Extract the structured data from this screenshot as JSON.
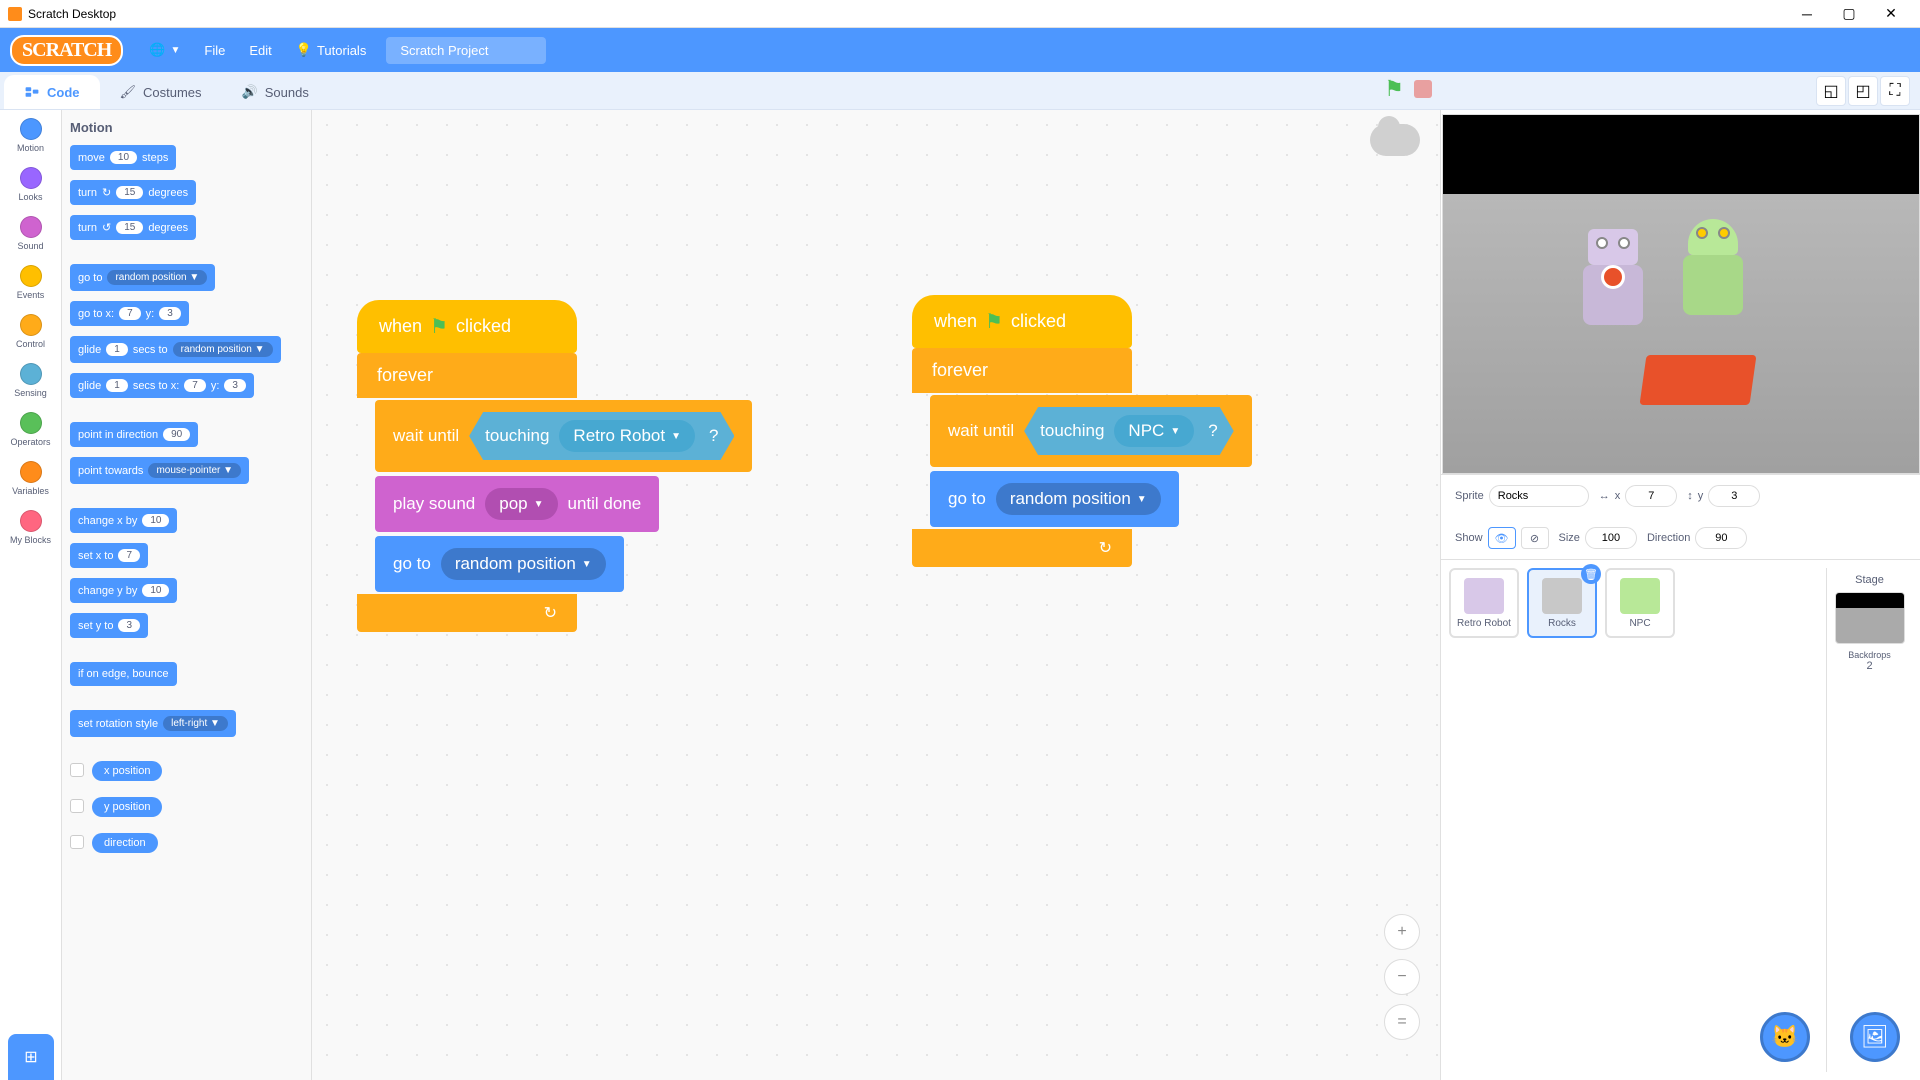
{
  "window_title": "Scratch Desktop",
  "menubar": {
    "logo": "SCRATCH",
    "file": "File",
    "edit": "Edit",
    "tutorials": "Tutorials",
    "project_name": "Scratch Project"
  },
  "tabs": {
    "code": "Code",
    "costumes": "Costumes",
    "sounds": "Sounds"
  },
  "categories": [
    {
      "label": "Motion",
      "color": "#4c97ff"
    },
    {
      "label": "Looks",
      "color": "#9966ff"
    },
    {
      "label": "Sound",
      "color": "#cf63cf"
    },
    {
      "label": "Events",
      "color": "#ffbf00"
    },
    {
      "label": "Control",
      "color": "#ffab19"
    },
    {
      "label": "Sensing",
      "color": "#5cb1d6"
    },
    {
      "label": "Operators",
      "color": "#59c059"
    },
    {
      "label": "Variables",
      "color": "#ff8c1a"
    },
    {
      "label": "My Blocks",
      "color": "#ff6680"
    }
  ],
  "palette": {
    "heading": "Motion",
    "move": {
      "t1": "move",
      "v": "10",
      "t2": "steps"
    },
    "turn_cw": {
      "t1": "turn",
      "v": "15",
      "t2": "degrees"
    },
    "turn_ccw": {
      "t1": "turn",
      "v": "15",
      "t2": "degrees"
    },
    "goto": {
      "t1": "go to",
      "dd": "random position"
    },
    "gotoxy": {
      "t1": "go to x:",
      "x": "7",
      "t2": "y:",
      "y": "3"
    },
    "glide": {
      "t1": "glide",
      "s": "1",
      "t2": "secs to",
      "dd": "random position"
    },
    "glidexy": {
      "t1": "glide",
      "s": "1",
      "t2": "secs to x:",
      "x": "7",
      "t3": "y:",
      "y": "3"
    },
    "pointdir": {
      "t1": "point in direction",
      "v": "90"
    },
    "pointtow": {
      "t1": "point towards",
      "dd": "mouse-pointer"
    },
    "changex": {
      "t1": "change x by",
      "v": "10"
    },
    "setx": {
      "t1": "set x to",
      "v": "7"
    },
    "changey": {
      "t1": "change y by",
      "v": "10"
    },
    "sety": {
      "t1": "set y to",
      "v": "3"
    },
    "bounce": "if on edge, bounce",
    "rotstyle": {
      "t1": "set rotation style",
      "dd": "left-right"
    },
    "xpos": "x position",
    "ypos": "y position",
    "dir": "direction"
  },
  "scripts": {
    "hat": {
      "t1": "when",
      "t2": "clicked"
    },
    "forever": "forever",
    "wait_until": "wait until",
    "touching": "touching",
    "s1_target": "Retro Robot",
    "s2_target": "NPC",
    "q": "?",
    "play_sound": {
      "t1": "play sound",
      "dd": "pop",
      "t2": "until done"
    },
    "goto": {
      "t1": "go to",
      "dd": "random position"
    }
  },
  "sprite_info": {
    "sprite_label": "Sprite",
    "name": "Rocks",
    "x_label": "x",
    "x": "7",
    "y_label": "y",
    "y": "3",
    "show_label": "Show",
    "size_label": "Size",
    "size": "100",
    "dir_label": "Direction",
    "dir": "90"
  },
  "sprites": [
    {
      "name": "Retro Robot"
    },
    {
      "name": "Rocks"
    },
    {
      "name": "NPC"
    }
  ],
  "stage_panel": {
    "label": "Stage",
    "backdrops_label": "Backdrops",
    "count": "2"
  },
  "zoom": {
    "in": "+",
    "out": "−",
    "eq": "="
  }
}
